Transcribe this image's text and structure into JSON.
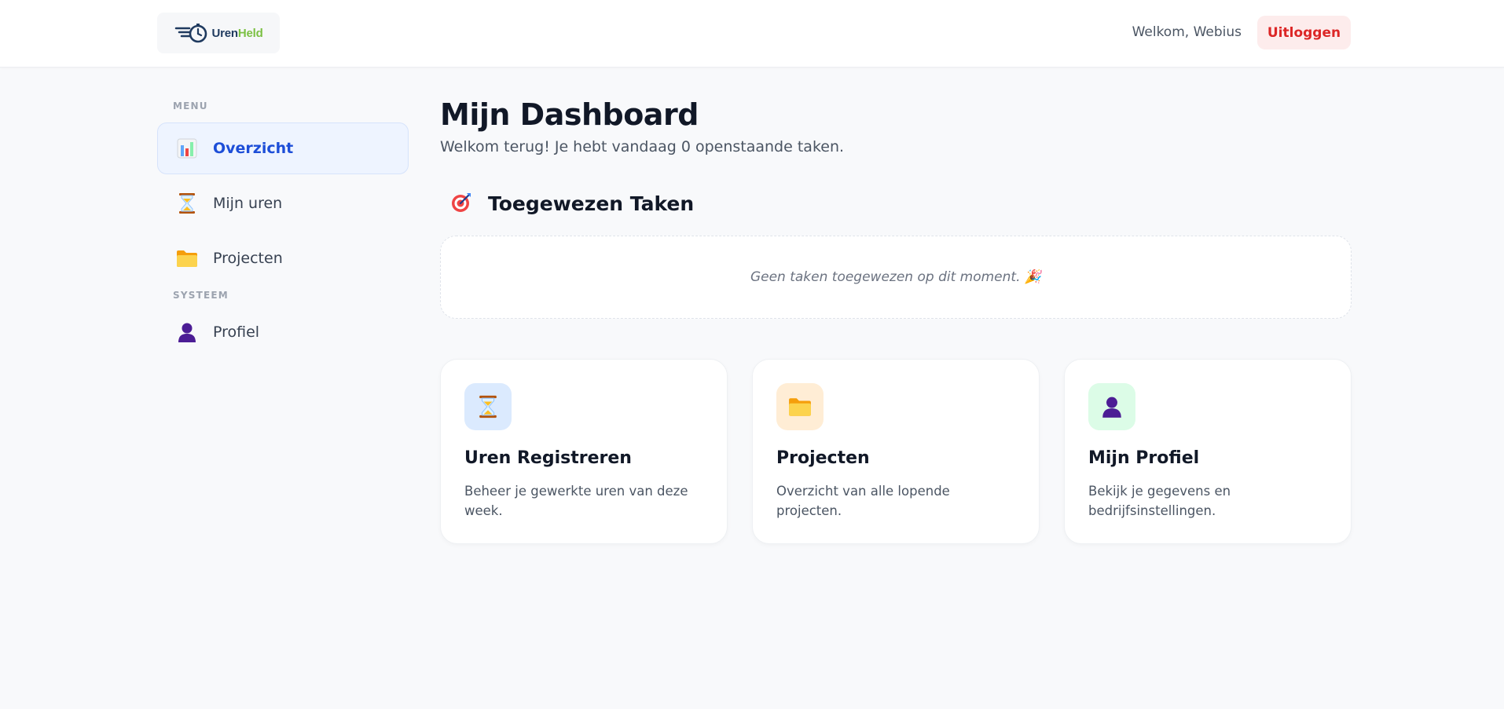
{
  "header": {
    "logo_text_part1": "Uren",
    "logo_text_part2": "Held",
    "welcome_text": "Welkom, Webius",
    "logout_label": "Uitloggen"
  },
  "sidebar": {
    "menu_heading": "MENU",
    "items": [
      {
        "label": "Overzicht",
        "icon": "bar-chart-icon",
        "active": true
      },
      {
        "label": "Mijn uren",
        "icon": "hourglass-icon",
        "active": false
      },
      {
        "label": "Projecten",
        "icon": "folder-icon",
        "active": false
      }
    ],
    "system_heading": "SYSTEEM",
    "system_items": [
      {
        "label": "Profiel",
        "icon": "user-silhouette-icon",
        "active": false
      }
    ]
  },
  "main": {
    "title": "Mijn Dashboard",
    "subtitle": "Welkom terug! Je hebt vandaag 0 openstaande taken.",
    "tasks_section_title": "Toegewezen Taken",
    "tasks_section_icon": "target-icon",
    "empty_tasks_text": "Geen taken toegewezen op dit moment. 🎉",
    "cards": [
      {
        "title": "Uren Registreren",
        "description": "Beheer je gewerkte uren van deze week.",
        "icon": "hourglass-icon",
        "icon_bg": "#dbeafe"
      },
      {
        "title": "Projecten",
        "description": "Overzicht van alle lopende projecten.",
        "icon": "folder-icon",
        "icon_bg": "#ffedd5"
      },
      {
        "title": "Mijn Profiel",
        "description": "Bekijk je gegevens en bedrijfsinstellingen.",
        "icon": "user-silhouette-icon",
        "icon_bg": "#dcfce7"
      }
    ]
  },
  "colors": {
    "accent": "#1d4ed8",
    "active_bg": "#eef4ff",
    "danger": "#dc2626",
    "danger_bg": "#fdecec",
    "page_bg": "#f8f9fb"
  }
}
